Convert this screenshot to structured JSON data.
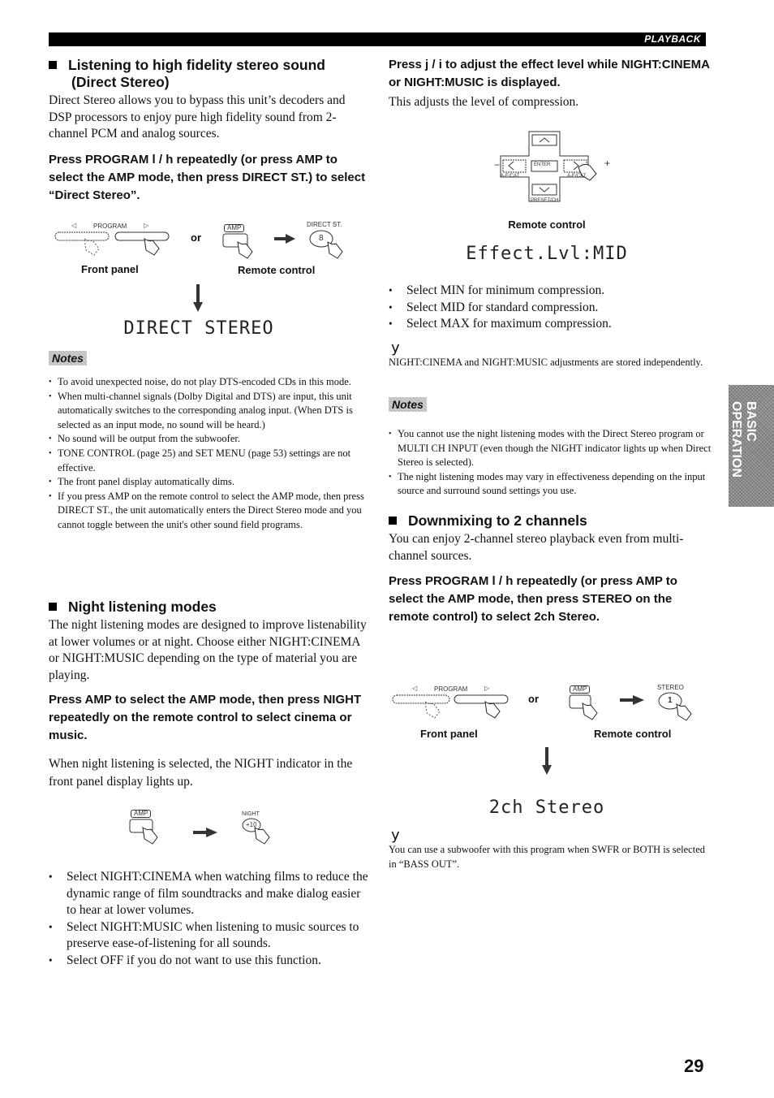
{
  "header": {
    "section_label": "PLAYBACK"
  },
  "side_tab": {
    "line1": "BASIC",
    "line2": "OPERATION"
  },
  "page_number": "29",
  "direct_stereo": {
    "heading_line1": "Listening to high fidelity stereo sound",
    "heading_line2": "(Direct Stereo)",
    "intro": "Direct Stereo allows you to bypass this unit’s decoders and DSP processors to enjoy pure high fidelity sound from 2-channel PCM and analog sources.",
    "instruction": "Press PROGRAM l / h repeatedly (or press AMP to select the AMP mode, then press DIRECT ST.) to select “Direct Stereo”.",
    "figure": {
      "program_label": "PROGRAM",
      "or_label": "or",
      "amp_label": "AMP",
      "direct_st_label": "DIRECT ST.",
      "direct_st_key": "8",
      "front_panel_caption": "Front panel",
      "remote_caption": "Remote control"
    },
    "display_text": "DIRECT STEREO",
    "notes_label": "Notes",
    "notes": [
      "To avoid unexpected noise, do not play DTS-encoded CDs in this mode.",
      "When multi-channel signals (Dolby Digital and DTS) are input, this unit automatically switches to the corresponding analog input. (When DTS is selected as an input mode, no sound will be heard.)",
      "No sound will be output from the subwoofer.",
      "TONE CONTROL (page 25) and SET MENU (page 53) settings are not effective.",
      "The front panel display automatically dims.",
      "If you press AMP on the remote control to select the AMP mode, then press DIRECT ST., the unit automatically enters the Direct Stereo mode and you cannot toggle between the unit's other sound field programs."
    ]
  },
  "night": {
    "heading": "Night listening modes",
    "intro": "The night listening modes are designed to improve listenability at lower volumes or at night. Choose either NIGHT:CINEMA or NIGHT:MUSIC depending on the type of material you are playing.",
    "instruction": "Press AMP to select the AMP mode, then press NIGHT repeatedly on the remote control to select cinema or music.",
    "indicator_text": "When night listening is selected, the NIGHT indicator in the front panel display lights up.",
    "figure": {
      "amp_label": "AMP",
      "night_label": "NIGHT",
      "night_key": "+10"
    },
    "options": [
      "Select NIGHT:CINEMA when watching films to reduce the dynamic range of film soundtracks and make dialog easier to hear at lower volumes.",
      "Select NIGHT:MUSIC when listening to music sources to preserve ease-of-listening for all sounds.",
      "Select OFF if you do not want to use this function."
    ]
  },
  "effect": {
    "instruction": "Press j / i to adjust the effect level while NIGHT:CINEMA or NIGHT:MUSIC is displayed.",
    "description": "This adjusts the level of compression.",
    "figure": {
      "enter_label": "ENTER",
      "left_label": "A-E/CAT.",
      "right_label": "A-E/CAT.",
      "bottom_label": "PRESET/CH",
      "minus": "−",
      "plus": "+",
      "caption": "Remote control"
    },
    "display_text": "Effect.Lvl:MID",
    "levels": [
      "Select MIN for minimum compression.",
      "Select MID for standard compression.",
      "Select MAX for maximum compression."
    ],
    "tip_icon": "y",
    "tip": "NIGHT:CINEMA and NIGHT:MUSIC adjustments are stored independently.",
    "notes_label": "Notes",
    "notes": [
      "You cannot use the night listening modes with the Direct Stereo program or MULTI CH INPUT (even though the NIGHT indicator lights up when Direct Stereo is selected).",
      "The night listening modes may vary in effectiveness depending on the input source and surround sound settings you use."
    ]
  },
  "downmix": {
    "heading": "Downmixing to 2 channels",
    "intro": "You can enjoy 2-channel stereo playback even from multi-channel sources.",
    "instruction": "Press PROGRAM l / h repeatedly (or press AMP to select the AMP mode, then press STEREO on the remote control) to select 2ch Stereo.",
    "figure": {
      "program_label": "PROGRAM",
      "or_label": "or",
      "amp_label": "AMP",
      "stereo_label": "STEREO",
      "stereo_key": "1",
      "front_panel_caption": "Front panel",
      "remote_caption": "Remote control"
    },
    "display_text": "2ch Stereo",
    "tip_icon": "y",
    "tip": "You can use a subwoofer with this program when SWFR or BOTH is selected in “BASS OUT”."
  }
}
